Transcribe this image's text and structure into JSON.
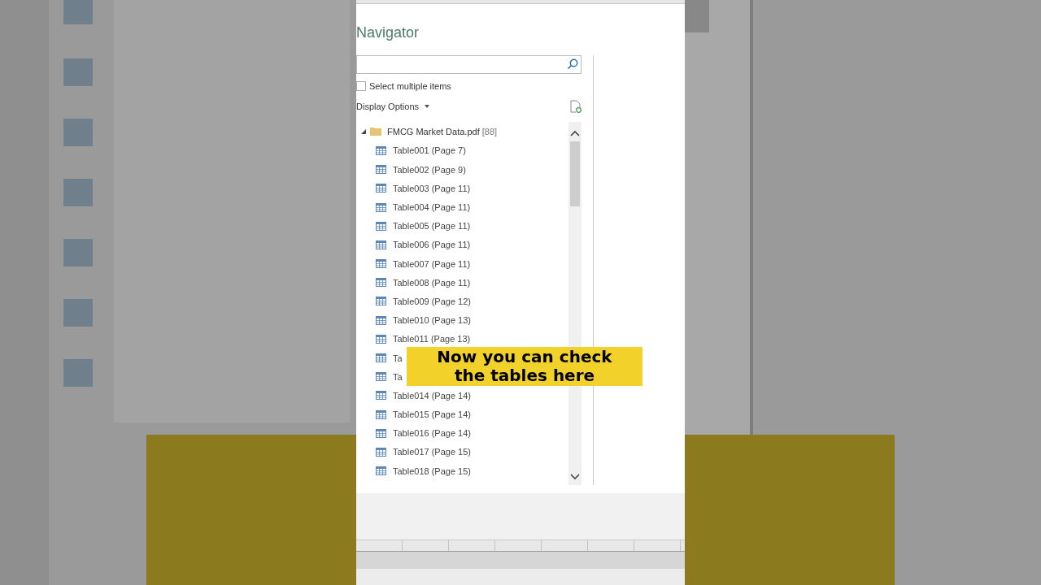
{
  "title": "Navigator",
  "select_multiple": {
    "label": "Select multiple items",
    "checked": false
  },
  "display_options": {
    "label": "Display Options"
  },
  "tree": {
    "label": "FMCG Market Data.pdf",
    "count": "[88]",
    "expanded": true,
    "children": [
      {
        "label": "Table001 (Page 7)",
        "selected": false
      },
      {
        "label": "Table002 (Page 9)",
        "selected": false
      },
      {
        "label": "Table003 (Page 11)",
        "selected": false
      },
      {
        "label": "Table004 (Page 11)",
        "selected": false
      },
      {
        "label": "Table005 (Page 11)",
        "selected": false
      },
      {
        "label": "Table006 (Page 11)",
        "selected": false
      },
      {
        "label": "Table007 (Page 11)",
        "selected": false
      },
      {
        "label": "Table008 (Page 11)",
        "selected": false
      },
      {
        "label": "Table009 (Page 12)",
        "selected": false
      },
      {
        "label": "Table010 (Page 13)",
        "selected": false
      },
      {
        "label": "Table011 (Page 13)",
        "selected": false
      },
      {
        "label": "Ta",
        "selected": false
      },
      {
        "label": "Ta",
        "selected": false
      },
      {
        "label": "Table014 (Page 14)",
        "selected": false
      },
      {
        "label": "Table015 (Page 14)",
        "selected": false
      },
      {
        "label": "Table016 (Page 14)",
        "selected": false
      },
      {
        "label": "Table017 (Page 15)",
        "selected": false
      },
      {
        "label": "Table018 (Page 15)",
        "selected": false
      }
    ]
  },
  "caption": [
    "Now you can check",
    "the tables here"
  ]
}
